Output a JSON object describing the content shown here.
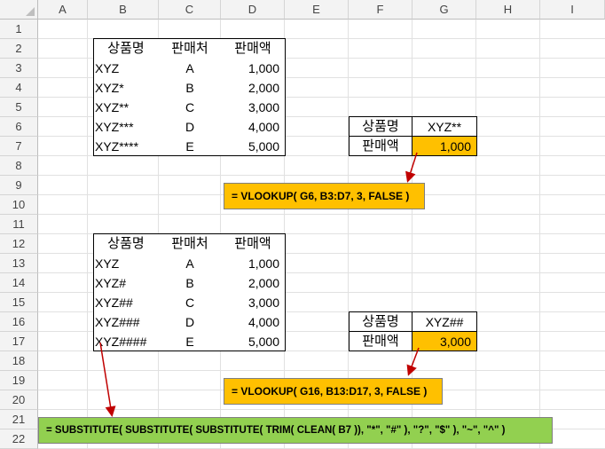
{
  "columns": [
    "A",
    "B",
    "C",
    "D",
    "E",
    "F",
    "G",
    "H",
    "I"
  ],
  "rows": [
    "1",
    "2",
    "3",
    "4",
    "5",
    "6",
    "7",
    "8",
    "9",
    "10",
    "11",
    "12",
    "13",
    "14",
    "15",
    "16",
    "17",
    "18",
    "19",
    "20",
    "21",
    "22"
  ],
  "table1": {
    "headers": [
      "상품명",
      "판매처",
      "판매액"
    ],
    "rows": [
      [
        "XYZ",
        "A",
        "1,000"
      ],
      [
        "XYZ*",
        "B",
        "2,000"
      ],
      [
        "XYZ**",
        "C",
        "3,000"
      ],
      [
        "XYZ***",
        "D",
        "4,000"
      ],
      [
        "XYZ****",
        "E",
        "5,000"
      ]
    ]
  },
  "lookup1": {
    "label1": "상품명",
    "value1": "XYZ**",
    "label2": "판매액",
    "value2": "1,000"
  },
  "formula1": "= VLOOKUP( G6, B3:D7, 3, FALSE )",
  "table2": {
    "headers": [
      "상품명",
      "판매처",
      "판매액"
    ],
    "rows": [
      [
        "XYZ",
        "A",
        "1,000"
      ],
      [
        "XYZ#",
        "B",
        "2,000"
      ],
      [
        "XYZ##",
        "C",
        "3,000"
      ],
      [
        "XYZ###",
        "D",
        "4,000"
      ],
      [
        "XYZ####",
        "E",
        "5,000"
      ]
    ]
  },
  "lookup2": {
    "label1": "상품명",
    "value1": "XYZ##",
    "label2": "판매액",
    "value2": "3,000"
  },
  "formula2": "= VLOOKUP( G16, B13:D17, 3, FALSE )",
  "formula3": "= SUBSTITUTE( SUBSTITUTE( SUBSTITUTE( TRIM( CLEAN( B7 )), \"*\", \"#\" ), \"?\", \"$\" ), \"~\", \"^\" )",
  "colors": {
    "highlight": "#ffc000",
    "formula_green": "#92d050",
    "arrow": "#c00000"
  }
}
